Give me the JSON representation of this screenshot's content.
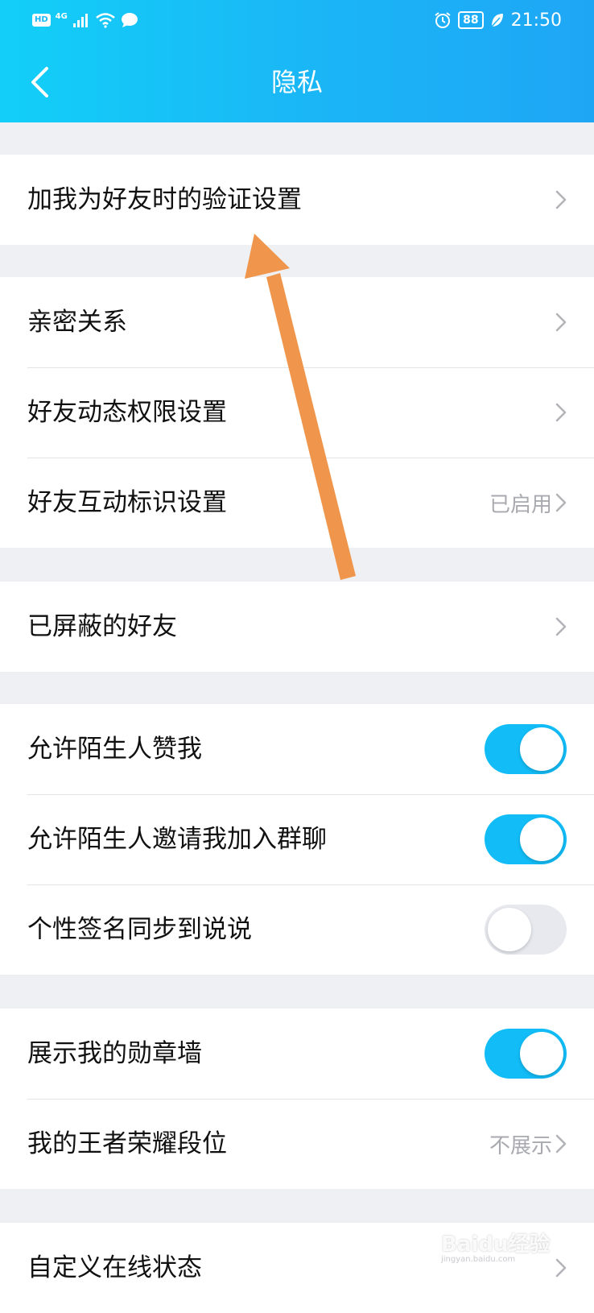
{
  "status_bar": {
    "hd": "HD",
    "network": "4G",
    "battery": "88",
    "time": "21:50",
    "icons": [
      "signal-icon",
      "wifi-icon",
      "chat-bubble-icon",
      "alarm-icon",
      "leaf-icon"
    ]
  },
  "header": {
    "title": "隐私"
  },
  "groups": [
    {
      "rows": [
        {
          "label": "加我为好友时的验证设置",
          "type": "link"
        }
      ]
    },
    {
      "rows": [
        {
          "label": "亲密关系",
          "type": "link"
        },
        {
          "label": "好友动态权限设置",
          "type": "link"
        },
        {
          "label": "好友互动标识设置",
          "type": "link",
          "value": "已启用"
        }
      ]
    },
    {
      "rows": [
        {
          "label": "已屏蔽的好友",
          "type": "link"
        }
      ]
    },
    {
      "rows": [
        {
          "label": "允许陌生人赞我",
          "type": "toggle",
          "on": true
        },
        {
          "label": "允许陌生人邀请我加入群聊",
          "type": "toggle",
          "on": true
        },
        {
          "label": "个性签名同步到说说",
          "type": "toggle",
          "on": false
        }
      ]
    },
    {
      "rows": [
        {
          "label": "展示我的勋章墙",
          "type": "toggle",
          "on": true
        },
        {
          "label": "我的王者荣耀段位",
          "type": "link",
          "value": "不展示"
        }
      ]
    },
    {
      "rows": [
        {
          "label": "自定义在线状态",
          "type": "link"
        }
      ]
    }
  ],
  "watermark": {
    "logo": "Baidu经验",
    "sub": "jingyan.baidu.com"
  },
  "colors": {
    "accent": "#12bcf6",
    "annotation_arrow": "#f0954c",
    "background": "#eff0f4"
  }
}
